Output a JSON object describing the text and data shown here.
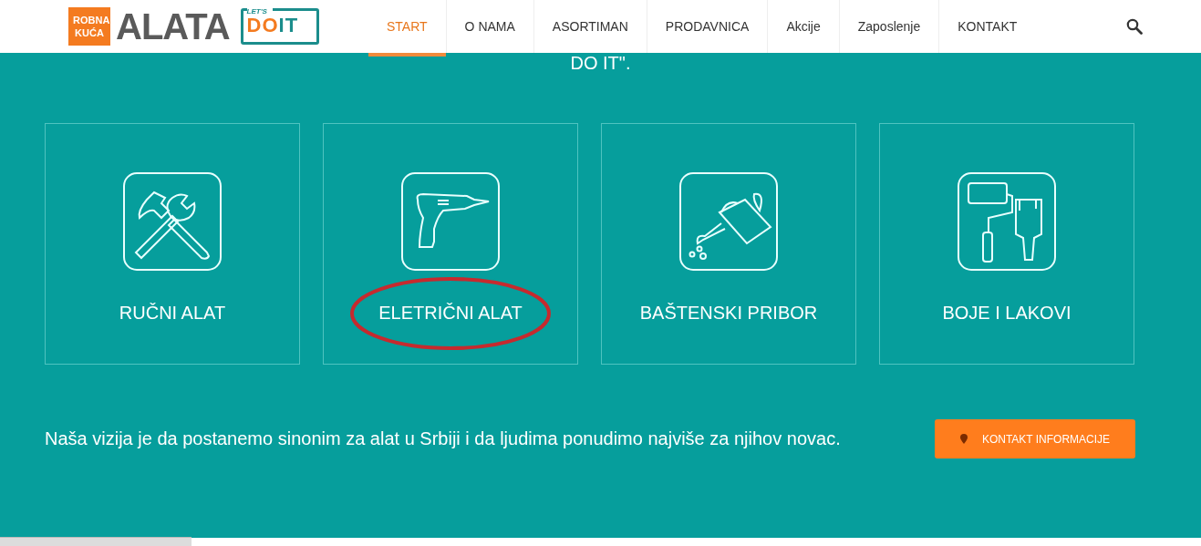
{
  "logo": {
    "badge_line_1": "ROBNA",
    "badge_line_2": "KUĆA",
    "wordmark": "ALATA",
    "slogan_small": "LET'S",
    "slogan_big_1": "DO",
    "slogan_big_2": "IT"
  },
  "nav": [
    {
      "label": "START",
      "selected": true
    },
    {
      "label": "O NAMA",
      "selected": false
    },
    {
      "label": "ASORTIMAN",
      "selected": false
    },
    {
      "label": "PRODAVNICA",
      "selected": false
    },
    {
      "label": "Akcije",
      "selected": false
    },
    {
      "label": "Zaposlenje",
      "selected": false
    },
    {
      "label": "KONTAKT",
      "selected": false
    }
  ],
  "intro_tail": "DO IT\".",
  "categories": [
    {
      "label": "RUČNI ALAT",
      "kind": "tools",
      "circled": false
    },
    {
      "label": "ELETRIČNI ALAT",
      "kind": "drill",
      "circled": true
    },
    {
      "label": "BAŠTENSKI PRIBOR",
      "kind": "watering",
      "circled": false
    },
    {
      "label": "BOJE I LAKOVI",
      "kind": "paint",
      "circled": false
    }
  ],
  "vision": "Naša vizija je da postanemo sinonim za alat u Srbiji i da ljudima ponudimo najviše za njihov novac.",
  "contact_button": "KONTAKT INFORMACIJE"
}
